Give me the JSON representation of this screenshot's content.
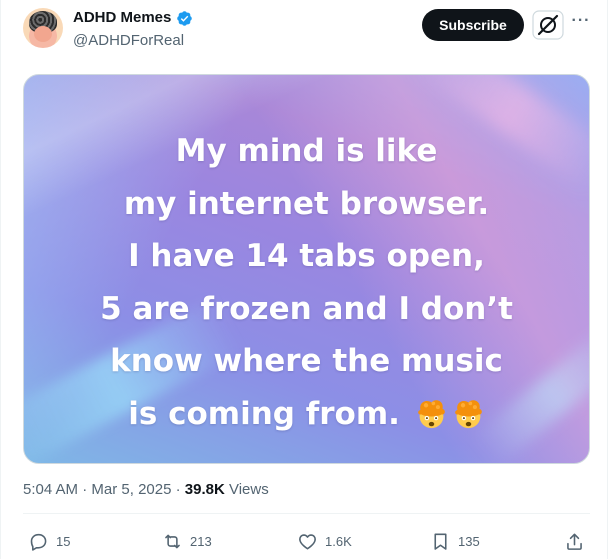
{
  "post": {
    "author": {
      "name": "ADHD Memes",
      "handle": "@ADHDForReal",
      "verified": true
    },
    "subscribe_label": "Subscribe",
    "more_label": "···",
    "image_text": [
      "My mind is like",
      "my internet browser.",
      "I have 14 tabs open,",
      "5 are frozen and I don’t",
      "know where the music",
      "is coming from."
    ],
    "image_emojis": [
      "exploding-head-emoji",
      "exploding-head-emoji"
    ],
    "time": "5:04 AM",
    "separator": " · ",
    "date": "Mar 5, 2025",
    "views_count": "39.8K",
    "views_label": " Views"
  },
  "actions": {
    "replies": "15",
    "reposts": "213",
    "likes": "1.6K",
    "bookmarks": "135"
  },
  "colors": {
    "text_primary": "#0f1419",
    "text_secondary": "#536471",
    "verified_blue": "#1d9bf0",
    "button_dark": "#0f1419",
    "border": "#cfd9de"
  },
  "icons": {
    "reply": "speech-bubble-icon",
    "repost": "repost-arrows-icon",
    "like": "heart-icon",
    "bookmark": "bookmark-icon",
    "share": "share-upload-icon",
    "grok": "grok-slash-icon",
    "verified": "verified-badge-icon"
  }
}
